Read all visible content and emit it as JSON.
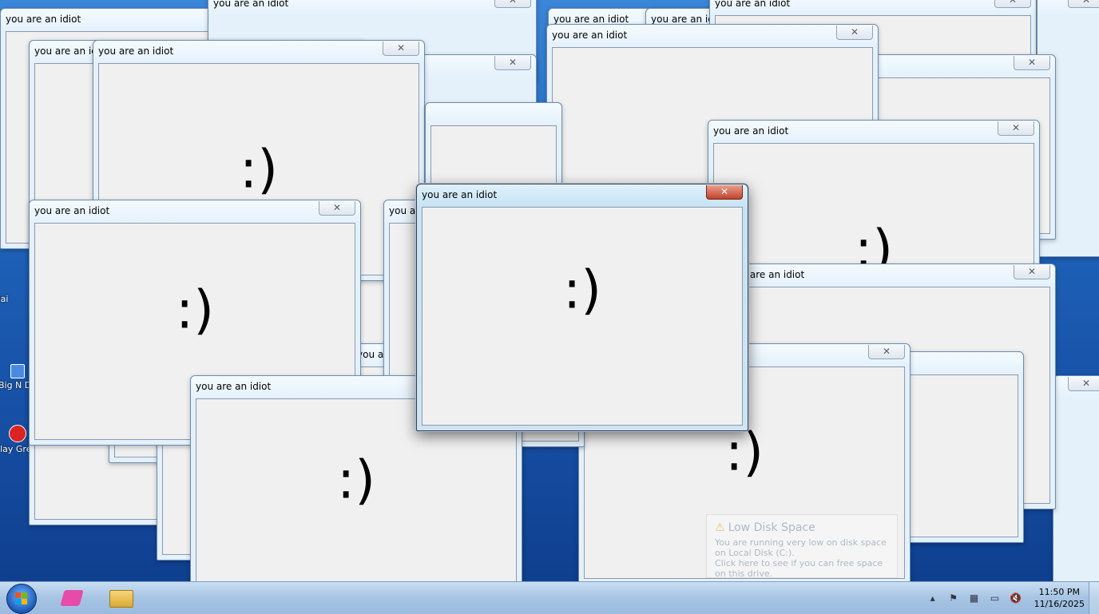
{
  "window": {
    "title": "you are an idiot",
    "close_glyph": "✕",
    "content": ":)"
  },
  "desktop_icons": [
    {
      "label": "lai"
    },
    {
      "label": "Big N De"
    },
    {
      "label": "Play Great"
    }
  ],
  "notification": {
    "icon": "warning-icon",
    "title": "Low Disk Space",
    "body": "You are running very low on disk space on Local Disk (C:).",
    "action": "Click here to see if you can free space on this drive."
  },
  "taskbar": {
    "apps": [
      {
        "name": "start-button",
        "icon": "windows-flag-icon"
      },
      {
        "name": "pink-app",
        "icon": "pink-box-icon"
      },
      {
        "name": "file-explorer",
        "icon": "folder-icon"
      }
    ],
    "tray": {
      "expand": "▴",
      "icons": [
        "flag-icon",
        "network-icon",
        "battery-icon",
        "volume-muted-icon"
      ],
      "time": "11:50 PM",
      "date": "11/16/2025"
    }
  },
  "colors": {
    "desktop": "#1d5fb6",
    "active_close": "#c2432c",
    "taskbar": "#a6c4e3"
  }
}
